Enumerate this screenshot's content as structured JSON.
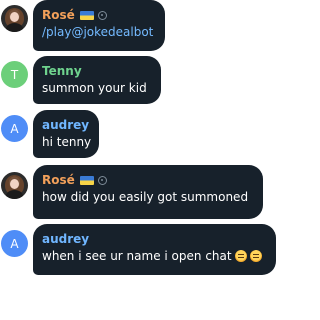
{
  "messages": [
    {
      "sender": "Rosé",
      "avatar_icon": "profile-photo",
      "text": "/play@jokedealbot",
      "link": true,
      "extras": [
        "ukraine-flag-icon",
        "status-icon"
      ]
    },
    {
      "sender": "Tenny",
      "avatar_letter": "T",
      "avatar_color": "#6ccf7a",
      "text": "summon your kid"
    },
    {
      "sender": "audrey",
      "avatar_letter": "A",
      "avatar_color": "#4f8df7",
      "text": "hi tenny"
    },
    {
      "sender": "Rosé",
      "avatar_icon": "profile-photo",
      "text": "how did you easily got summoned",
      "extras": [
        "ukraine-flag-icon",
        "status-icon"
      ]
    },
    {
      "sender": "audrey",
      "avatar_letter": "A",
      "avatar_color": "#4f8df7",
      "text": "when i see ur name i open chat",
      "emojis": [
        "pensive-face-emoji",
        "pensive-face-emoji"
      ]
    }
  ],
  "colors": {
    "bubble": "#17212b",
    "rose_name": "#f2a05a",
    "tenny_name": "#6fd38e",
    "audrey_name": "#70b6ff",
    "link": "#74baff"
  }
}
